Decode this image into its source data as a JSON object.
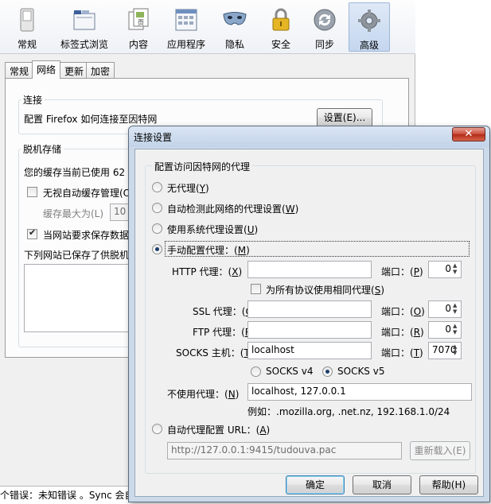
{
  "toolbar": {
    "items": [
      {
        "label": "常规",
        "icon": "switch-icon"
      },
      {
        "label": "标签式浏览",
        "icon": "tabs-icon"
      },
      {
        "label": "内容",
        "icon": "content-icon"
      },
      {
        "label": "应用程序",
        "icon": "applications-icon"
      },
      {
        "label": "隐私",
        "icon": "mask-icon"
      },
      {
        "label": "安全",
        "icon": "lock-icon"
      },
      {
        "label": "同步",
        "icon": "sync-icon"
      },
      {
        "label": "高级",
        "icon": "gear-icon"
      }
    ],
    "selected": "高级"
  },
  "tabs": [
    "常规",
    "网络",
    "更新",
    "加密"
  ],
  "active_tab": "网络",
  "connection": {
    "caption": "连接",
    "text": "配置 Firefox 如何连接至因特网",
    "settings_button": "设置(E)..."
  },
  "offline": {
    "caption": "脱机存储",
    "cache_text": "您的缓存当前已使用 62",
    "override_label": "无视自动缓存管理(O",
    "limit_label": "缓存最大为(L)",
    "limit_value": "10",
    "ask_label": "当网站要求保存数据",
    "sites_label": "下列网站已保存了供脱机"
  },
  "status_bar": "个错误：未知错误 。Sync 会自",
  "dialog": {
    "title": "连接设置",
    "close": "✕",
    "group_caption": "配置访问因特网的代理",
    "options": {
      "no_proxy": {
        "text": "无代理",
        "key": "Y"
      },
      "auto_detect": {
        "text": "自动检测此网络的代理设置",
        "key": "W"
      },
      "system": {
        "text": "使用系统代理设置",
        "key": "U"
      },
      "manual": {
        "text": "手动配置代理：",
        "key": "M"
      }
    },
    "http": {
      "label": "HTTP 代理：",
      "key": "X",
      "value": "",
      "port_label": "端口：",
      "port_key": "P",
      "port": "0"
    },
    "same_proxy": {
      "text": "为所有协议使用相同代理",
      "key": "S"
    },
    "ssl": {
      "label": "SSL 代理：",
      "key": "O",
      "port_label": "端口：",
      "port": "0"
    },
    "ftp": {
      "label": "FTP 代理：",
      "key": "R",
      "port_label": "端口：",
      "port": "0"
    },
    "socks": {
      "label": "SOCKS 主机：",
      "key": "T",
      "value": "localhost",
      "port_label": "端口：",
      "port": "7070"
    },
    "socks_v4": "SOCKS v4",
    "socks_v5": "SOCKS v5",
    "no_proxy_for": {
      "label": "不使用代理：",
      "key": "N",
      "value": "localhost, 127.0.0.1"
    },
    "example": "例如：.mozilla.org, .net.nz, 192.168.1.0/24",
    "pac": {
      "text": "自动代理配置 URL：",
      "key": "A",
      "value": "http://127.0.0.1:9415/tudouva.pac",
      "reload": "重新载入(E)"
    },
    "buttons": {
      "ok": "确定",
      "cancel": "取消",
      "help": "帮助(H)"
    }
  }
}
